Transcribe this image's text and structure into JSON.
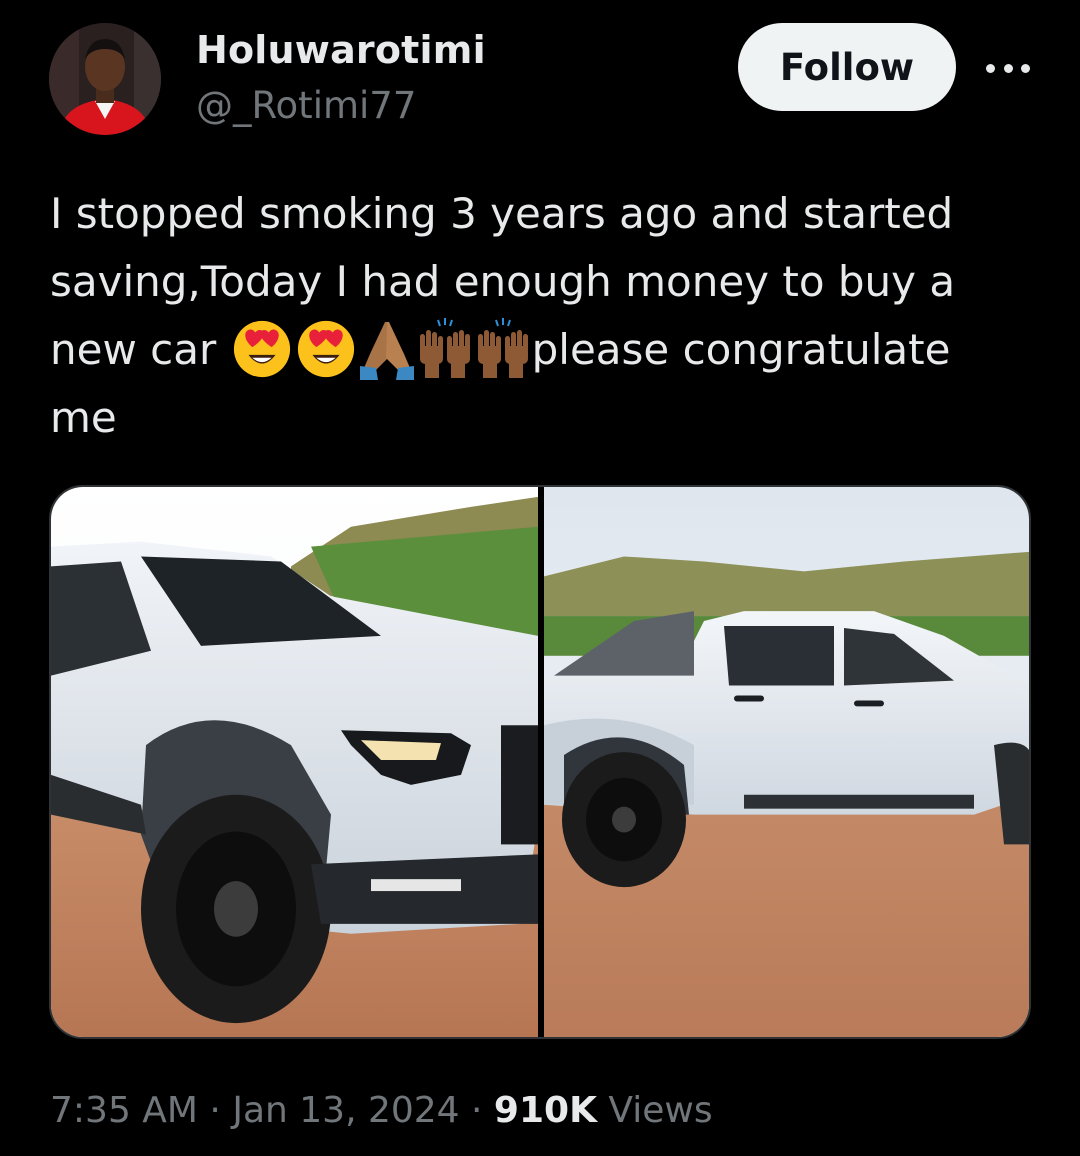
{
  "author": {
    "display_name": "Holuwarotimi",
    "handle": "@_Rotimi77",
    "avatar_icon": "profile-photo"
  },
  "actions": {
    "follow_label": "Follow",
    "more_icon": "ellipsis-icon"
  },
  "tweet": {
    "line1": "I stopped smoking 3 years ago and started",
    "line2": "saving,Today I had enough money to buy a",
    "line3_start": "new car ",
    "line3_end": "please congratulate",
    "line4": "me",
    "emojis": [
      "heart-eyes-emoji",
      "heart-eyes-emoji",
      "folded-hands-emoji",
      "raising-hands-emoji",
      "raising-hands-emoji"
    ]
  },
  "media": {
    "photos": [
      "white-pickup-truck-front-photo",
      "white-pickup-truck-side-photo"
    ]
  },
  "meta": {
    "time": "7:35 AM",
    "separator": " · ",
    "date": "Jan 13, 2024",
    "views_count": "910K",
    "views_label": " Views"
  },
  "colors": {
    "background": "#000000",
    "text_primary": "#e7e9ea",
    "text_secondary": "#71767b",
    "follow_bg": "#eff3f4"
  }
}
